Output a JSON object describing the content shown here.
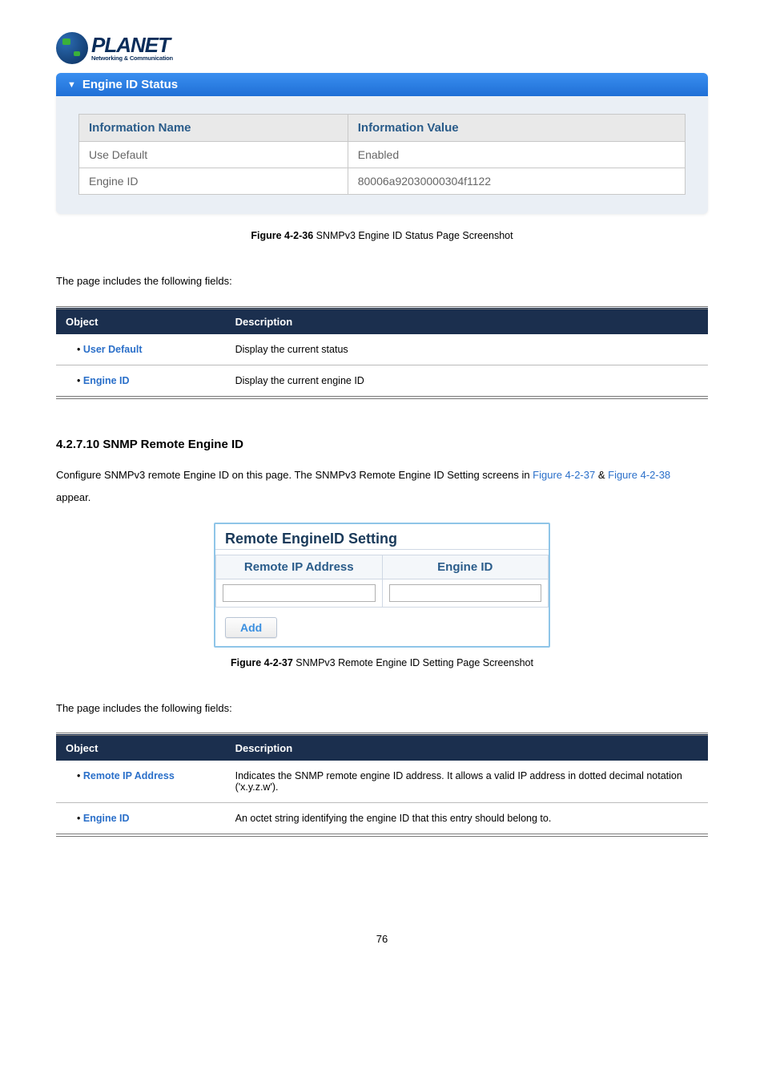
{
  "logo": {
    "name": "PLANET",
    "tagline": "Networking & Communication"
  },
  "status_panel": {
    "title": "Engine ID Status",
    "headers": {
      "name": "Information Name",
      "value": "Information Value"
    },
    "rows": [
      {
        "name": "Use Default",
        "value": "Enabled"
      },
      {
        "name": "Engine ID",
        "value": "80006a92030000304f1122"
      }
    ]
  },
  "caption1_prefix": "Figure 4-2-36",
  "caption1_text": " SNMPv3 Engine ID Status Page Screenshot",
  "fields_intro": "The page includes the following fields:",
  "table1": {
    "headers": {
      "object": "Object",
      "description": "Description"
    },
    "rows": [
      {
        "object": "User Default",
        "description": "Display the current status"
      },
      {
        "object": "Engine ID",
        "description": "Display the current engine ID"
      }
    ]
  },
  "section_title": "4.2.7.10 SNMP Remote Engine ID",
  "section_para_parts": {
    "p1": "Configure SNMPv3 remote Engine ID on this page. The SNMPv3 Remote Engine ID Setting screens in ",
    "link1": "Figure 4-2-37",
    "amp": " & ",
    "link2": "Figure 4-2-38",
    "p2": " appear."
  },
  "remote_panel": {
    "title": "Remote EngineID Setting",
    "headers": {
      "ip": "Remote IP Address",
      "engine": "Engine ID"
    },
    "inputs": {
      "ip": "",
      "engine": ""
    },
    "add_label": "Add"
  },
  "caption2_prefix": "Figure 4-2-37",
  "caption2_text": " SNMPv3 Remote Engine ID Setting Page Screenshot",
  "fields_intro2": "The page includes the following fields:",
  "table2": {
    "headers": {
      "object": "Object",
      "description": "Description"
    },
    "rows": [
      {
        "object": "Remote IP Address",
        "description": "Indicates the SNMP remote engine ID address. It allows a valid IP address in dotted decimal notation ('x.y.z.w')."
      },
      {
        "object": "Engine ID",
        "description": "An octet string identifying the engine ID that this entry should belong to."
      }
    ]
  },
  "page_number": "76"
}
